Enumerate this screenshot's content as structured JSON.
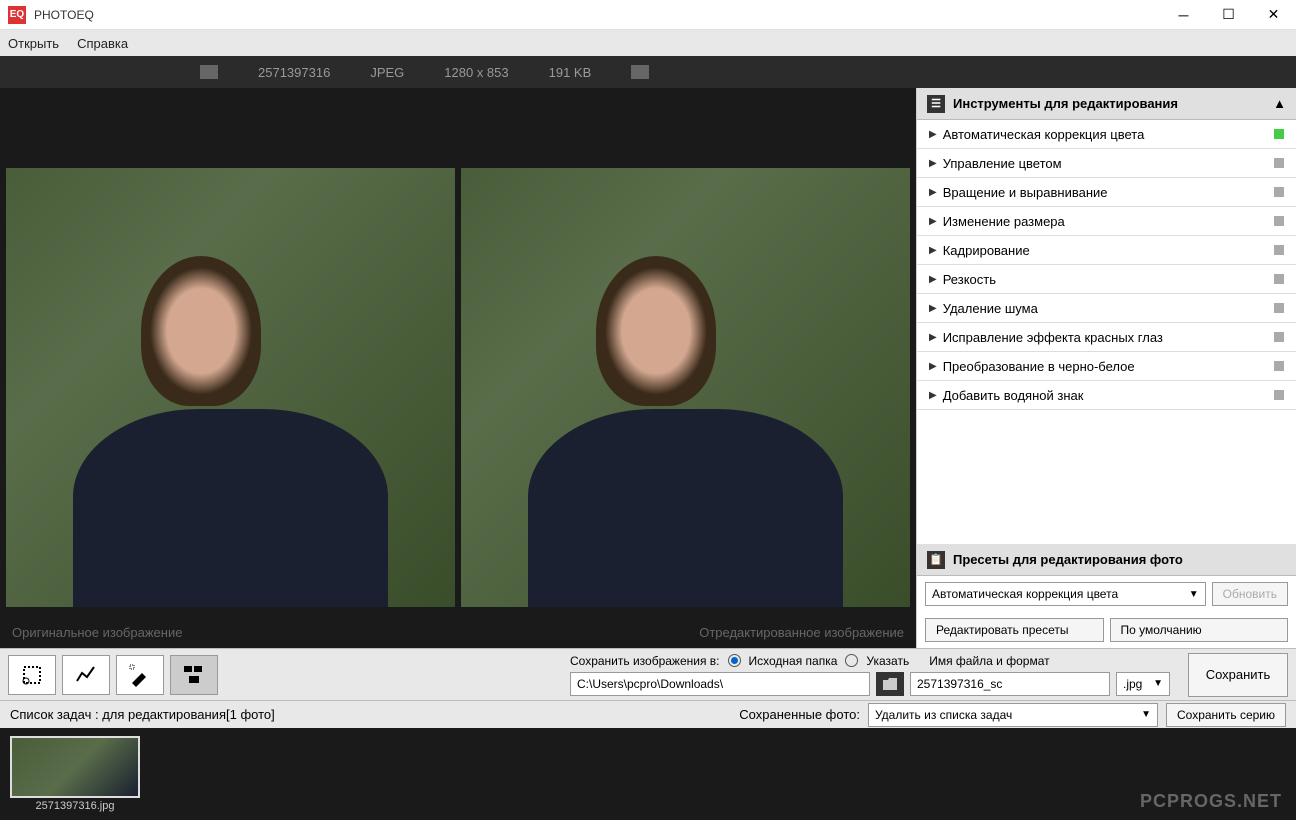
{
  "app": {
    "title": "PHOTOEQ"
  },
  "menu": {
    "open": "Открыть",
    "help": "Справка"
  },
  "info": {
    "id": "2571397316",
    "format": "JPEG",
    "dimensions": "1280 x 853",
    "size": "191 KB"
  },
  "images": {
    "original_label": "Оригинальное изображение",
    "edited_label": "Отредактированное изображение"
  },
  "sidebar": {
    "tools_header": "Инструменты для редактирования",
    "tools": [
      {
        "label": "Автоматическая коррекция цвета",
        "active": true
      },
      {
        "label": "Управление цветом",
        "active": false
      },
      {
        "label": "Вращение и выравнивание",
        "active": false
      },
      {
        "label": "Изменение размера",
        "active": false
      },
      {
        "label": "Кадрирование",
        "active": false
      },
      {
        "label": "Резкость",
        "active": false
      },
      {
        "label": "Удаление шума",
        "active": false
      },
      {
        "label": "Исправление эффекта красных глаз",
        "active": false
      },
      {
        "label": "Преобразование в черно-белое",
        "active": false
      },
      {
        "label": "Добавить водяной знак",
        "active": false
      }
    ],
    "presets_header": "Пресеты для редактирования фото",
    "preset_selected": "Автоматическая коррекция цвета",
    "refresh_btn": "Обновить",
    "edit_presets_btn": "Редактировать пресеты",
    "default_btn": "По умолчанию"
  },
  "save": {
    "label": "Сохранить изображения в:",
    "radio_source": "Исходная папка",
    "radio_specify": "Указать",
    "file_label": "Имя файла и формат",
    "path": "C:\\Users\\pcpro\\Downloads\\",
    "filename": "2571397316_sc",
    "ext": ".jpg",
    "save_btn": "Сохранить"
  },
  "tasks": {
    "label": "Список задач : для редактирования[1 фото]",
    "saved_label": "Сохраненные фото:",
    "action_selected": "Удалить из списка задач",
    "save_series_btn": "Сохранить серию"
  },
  "thumb": {
    "name": "2571397316.jpg"
  },
  "watermark": "PCPROGS.NET"
}
